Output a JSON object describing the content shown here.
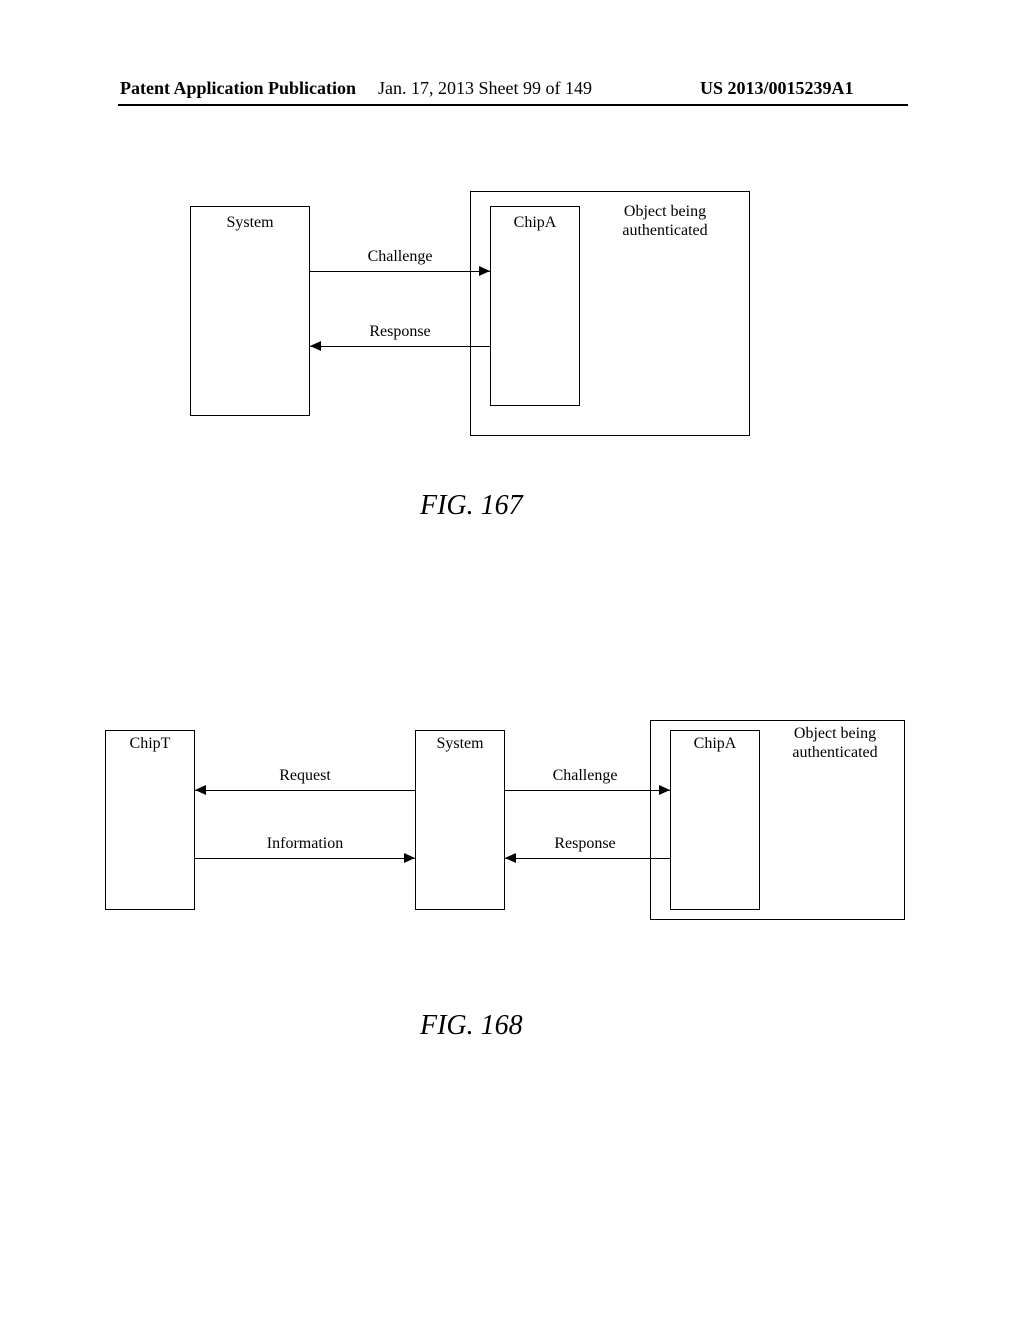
{
  "header": {
    "left": "Patent Application Publication",
    "center": "Jan. 17, 2013  Sheet 99 of 149",
    "right": "US 2013/0015239A1"
  },
  "fig167": {
    "system": "System",
    "chipa": "ChipA",
    "object": "Object being authenticated",
    "challenge": "Challenge",
    "response": "Response",
    "caption": "FIG. 167"
  },
  "fig168": {
    "chipt": "ChipT",
    "system": "System",
    "chipa": "ChipA",
    "object": "Object being authenticated",
    "request": "Request",
    "information": "Information",
    "challenge": "Challenge",
    "response": "Response",
    "caption": "FIG. 168"
  }
}
